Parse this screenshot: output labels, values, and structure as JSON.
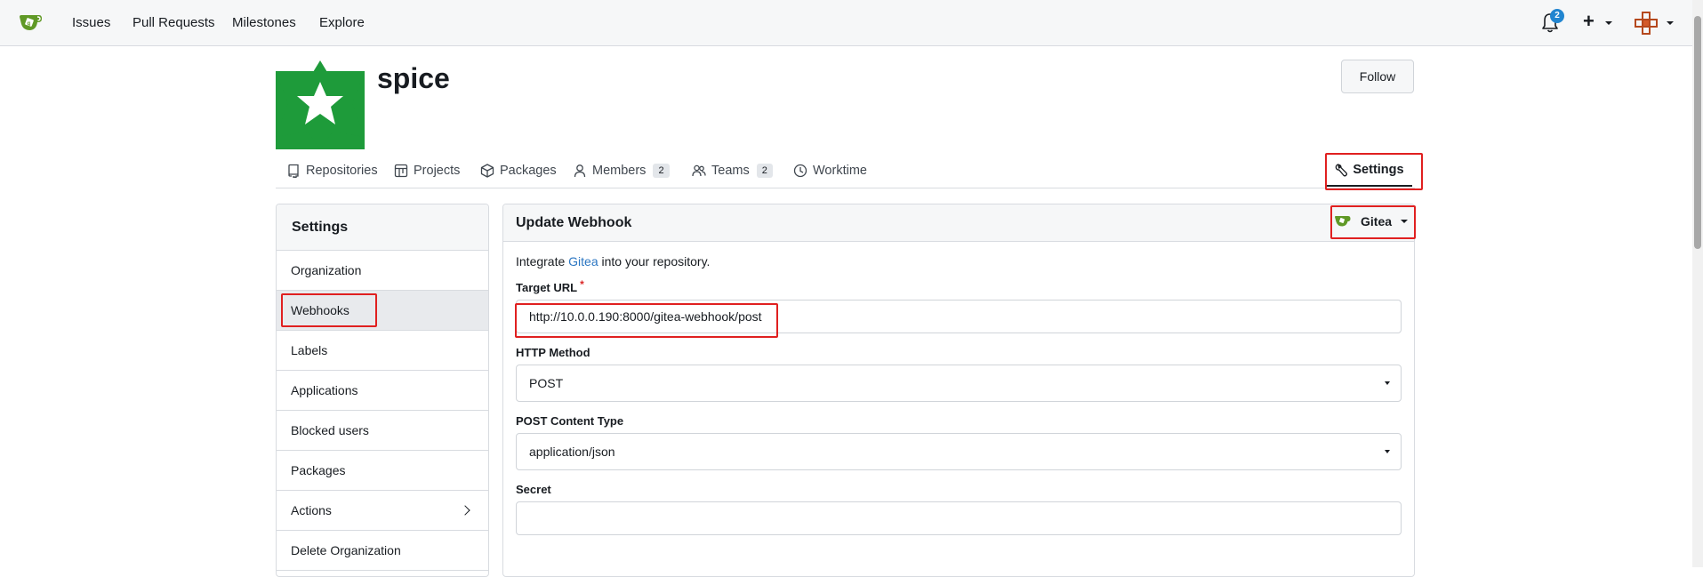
{
  "navbar": {
    "links": [
      "Issues",
      "Pull Requests",
      "Milestones",
      "Explore"
    ],
    "notification_count": "2",
    "plus_label": "+"
  },
  "org": {
    "name": "spice",
    "follow_label": "Follow"
  },
  "tabs": [
    {
      "label": "Repositories",
      "icon": "repo-icon"
    },
    {
      "label": "Projects",
      "icon": "project-icon"
    },
    {
      "label": "Packages",
      "icon": "package-icon"
    },
    {
      "label": "Members",
      "icon": "person-icon",
      "count": "2"
    },
    {
      "label": "Teams",
      "icon": "people-icon",
      "count": "2"
    },
    {
      "label": "Worktime",
      "icon": "clock-icon"
    }
  ],
  "settings_tab": {
    "label": "Settings",
    "icon": "tools-icon"
  },
  "sidebar": {
    "title": "Settings",
    "items": [
      {
        "label": "Organization"
      },
      {
        "label": "Webhooks",
        "active": true
      },
      {
        "label": "Labels"
      },
      {
        "label": "Applications"
      },
      {
        "label": "Blocked users"
      },
      {
        "label": "Packages"
      },
      {
        "label": "Actions",
        "has_submenu": true
      },
      {
        "label": "Delete Organization"
      }
    ]
  },
  "webhook": {
    "title": "Update Webhook",
    "type_label": "Gitea",
    "intro_prefix": "Integrate ",
    "intro_link": "Gitea",
    "intro_suffix": " into your repository.",
    "target_url_label": "Target URL",
    "required_mark": "*",
    "target_url_value": "http://10.0.0.190:8000/gitea-webhook/post",
    "http_method_label": "HTTP Method",
    "http_method_value": "POST",
    "content_type_label": "POST Content Type",
    "content_type_value": "application/json",
    "secret_label": "Secret",
    "secret_value": ""
  },
  "colors": {
    "brand_green": "#609926",
    "highlight_red": "#e02020",
    "link_blue": "#2b76c2",
    "badge_blue": "#2185d0"
  }
}
